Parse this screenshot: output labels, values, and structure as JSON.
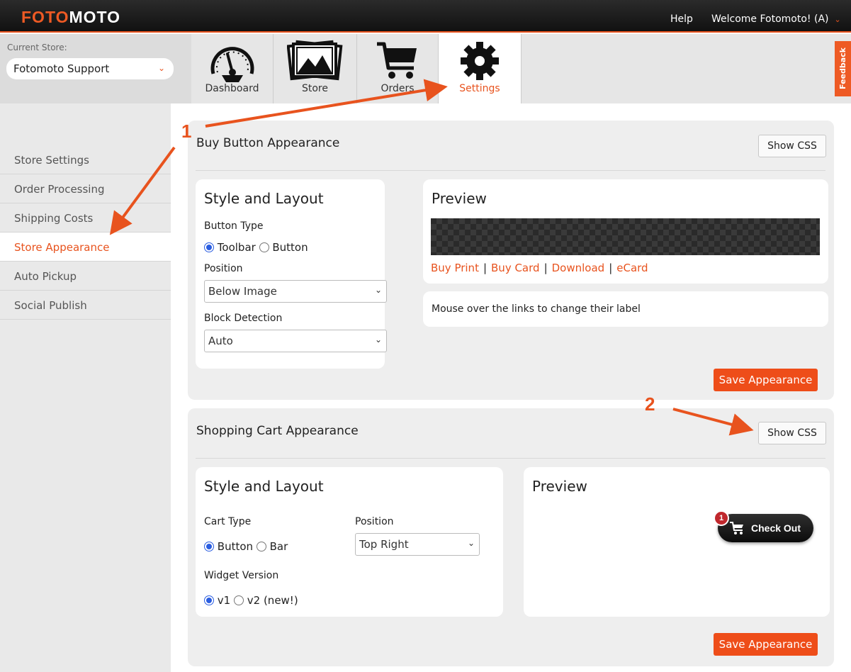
{
  "header": {
    "logo_part1": "FOTO",
    "logo_part2": "MOTO",
    "help": "Help",
    "welcome": "Welcome Fotomoto! (A)"
  },
  "store": {
    "label": "Current Store:",
    "value": "Fotomoto Support"
  },
  "tabs": [
    {
      "label": "Dashboard",
      "icon": "dashboard-gauge-icon"
    },
    {
      "label": "Store",
      "icon": "store-photos-icon"
    },
    {
      "label": "Orders",
      "icon": "orders-cart-icon"
    },
    {
      "label": "Settings",
      "icon": "settings-gear-icon",
      "active": true
    }
  ],
  "feedback": "Feedback",
  "sidebar": {
    "items": [
      {
        "label": "Store Settings"
      },
      {
        "label": "Order Processing"
      },
      {
        "label": "Shipping Costs"
      },
      {
        "label": "Store Appearance",
        "active": true
      },
      {
        "label": "Auto Pickup"
      },
      {
        "label": "Social Publish"
      }
    ]
  },
  "buy_button": {
    "title": "Buy Button Appearance",
    "show_css": "Show CSS",
    "style_title": "Style and Layout",
    "button_type_label": "Button Type",
    "button_type_options": [
      "Toolbar",
      "Button"
    ],
    "button_type_selected": "Toolbar",
    "position_label": "Position",
    "position_value": "Below Image",
    "block_detection_label": "Block Detection",
    "block_detection_value": "Auto",
    "preview_title": "Preview",
    "preview_links": [
      "Buy Print",
      "Buy Card",
      "Download",
      "eCard"
    ],
    "hint": "Mouse over the links to change their label",
    "save": "Save Appearance"
  },
  "cart": {
    "title": "Shopping Cart Appearance",
    "show_css": "Show CSS",
    "style_title": "Style and Layout",
    "cart_type_label": "Cart Type",
    "cart_type_options": [
      "Button",
      "Bar"
    ],
    "cart_type_selected": "Button",
    "position_label": "Position",
    "position_value": "Top Right",
    "widget_label": "Widget Version",
    "widget_options": [
      "v1",
      "v2 (new!)"
    ],
    "widget_selected": "v1",
    "preview_title": "Preview",
    "checkout_label": "Check Out",
    "checkout_count": "1",
    "save": "Save Appearance"
  },
  "annotations": {
    "step1": "1",
    "step2": "2",
    "arrow_color": "#e8531e"
  },
  "colors": {
    "accent": "#e8531e",
    "save_button": "#ee4d19",
    "radio": "#2a5de0"
  }
}
